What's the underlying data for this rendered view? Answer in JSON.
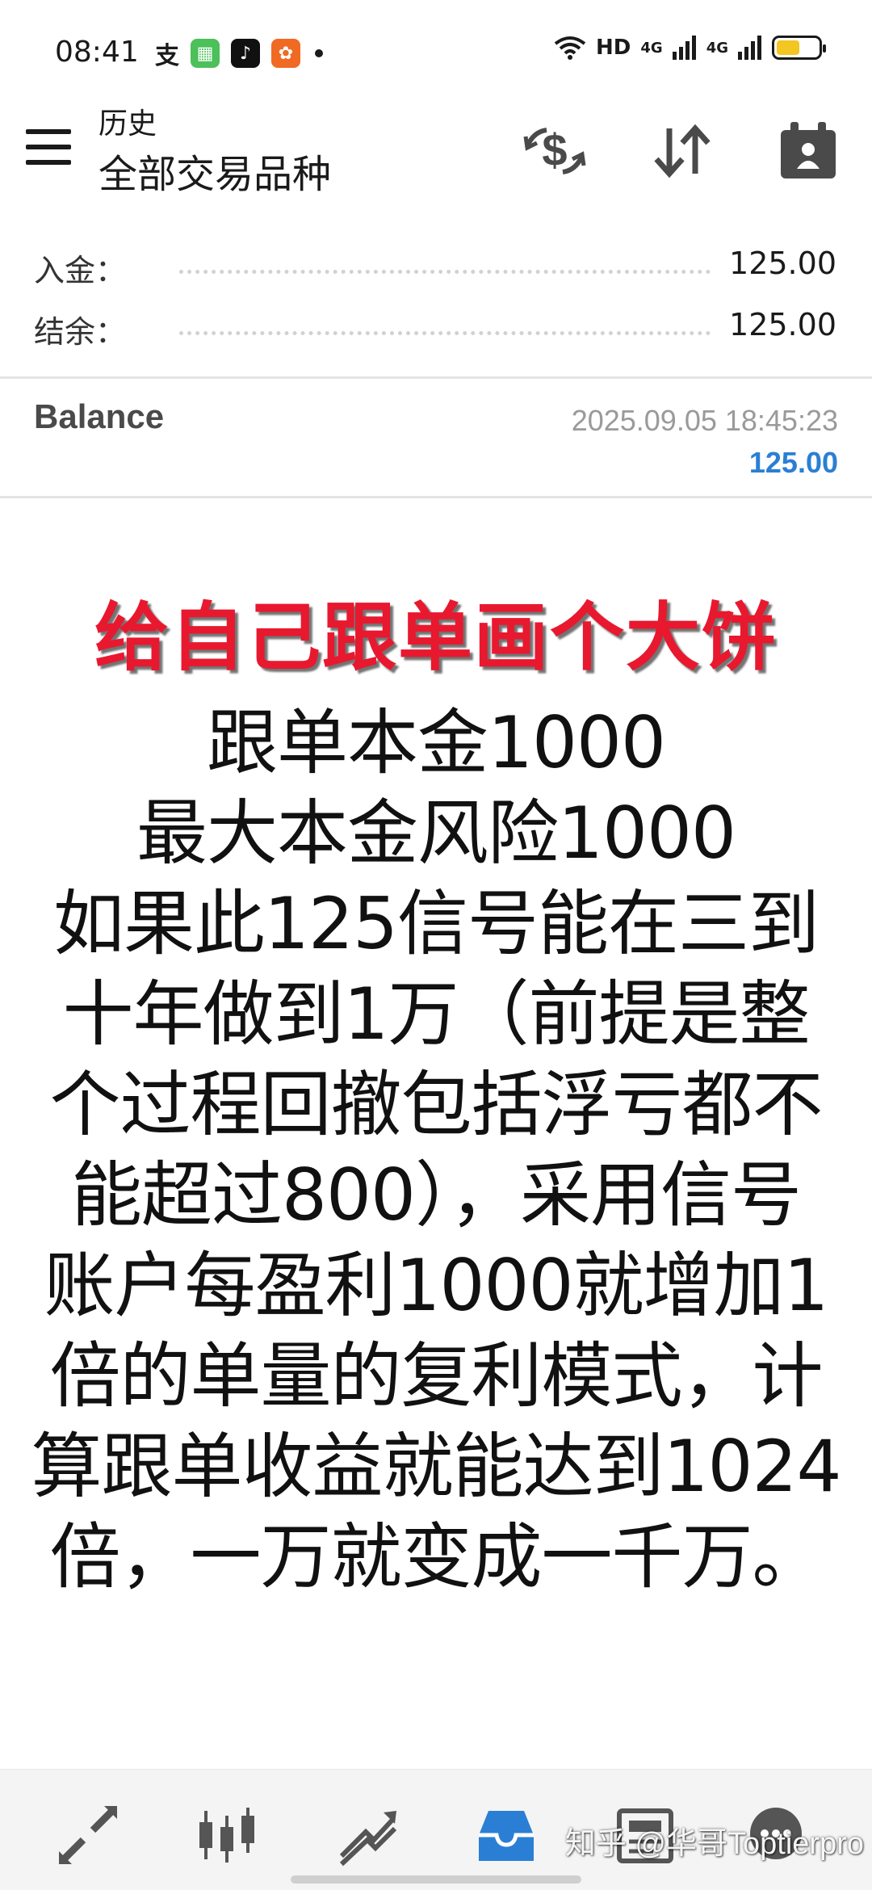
{
  "status_bar": {
    "time": "08:41",
    "network": "HD",
    "signal1": "4G",
    "signal2": "4G"
  },
  "header": {
    "subtitle": "历史",
    "title": "全部交易品种"
  },
  "summary": {
    "rows": [
      {
        "label": "入金：",
        "value": "125.00"
      },
      {
        "label": "结余：",
        "value": "125.00"
      }
    ]
  },
  "balance": {
    "title": "Balance",
    "datetime": "2025.09.05 18:45:23",
    "amount": "125.00"
  },
  "overlay": {
    "title": "给自己跟单画个大饼",
    "lines": [
      "跟单本金1000",
      "最大本金风险1000",
      "如果此125信号能在三到",
      "十年做到1万（前提是整",
      "个过程回撤包括浮亏都不",
      "能超过800），采用信号",
      "账户每盈利1000就增加1",
      "倍的单量的复利模式，计",
      "算跟单收益就能达到1024",
      "倍，一万就变成一千万。"
    ]
  },
  "watermark": "知乎 @华哥Toptierpro",
  "colors": {
    "accent_blue": "#2a7fd4",
    "title_red": "#e8182f",
    "battery": "#f3c622"
  },
  "icons": {
    "header": [
      "dollar-swap-icon",
      "sort-icon",
      "calendar-person-icon"
    ],
    "nav": [
      "quotes-icon",
      "chart-icon",
      "trade-icon",
      "history-icon",
      "news-icon",
      "messages-icon"
    ]
  }
}
